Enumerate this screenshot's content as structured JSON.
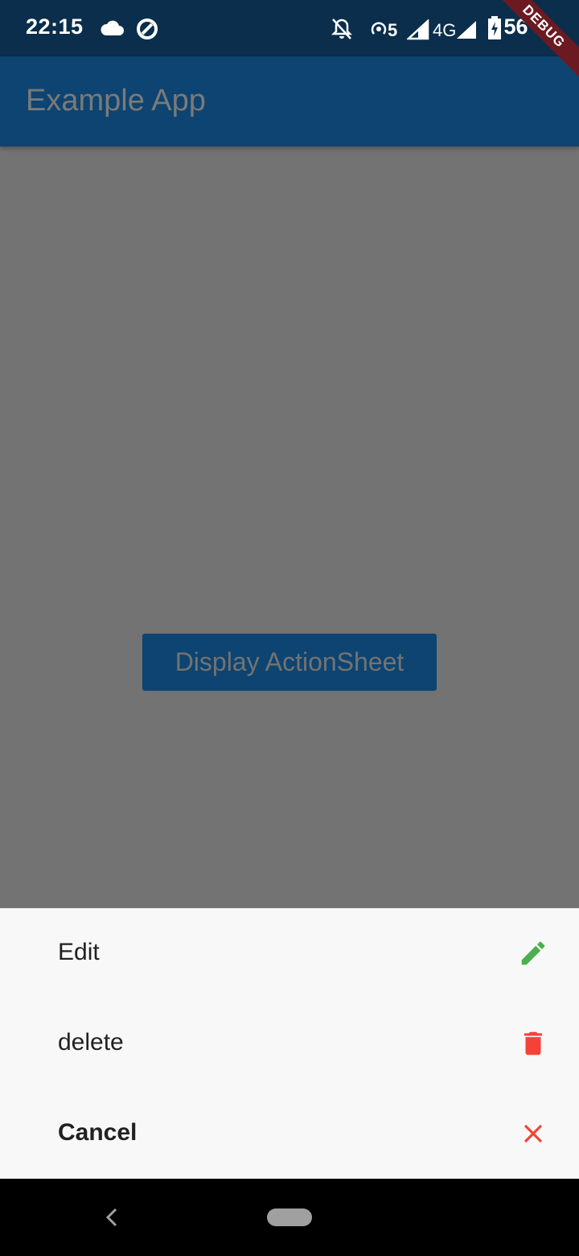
{
  "status_bar": {
    "time": "22:15",
    "network_label": "4G",
    "hotspot_count": "5",
    "battery": "56 %",
    "icons": [
      "cloud-icon",
      "circle-a-icon",
      "notifications-off-icon",
      "hotspot-icon",
      "signal-icon",
      "signal-icon",
      "battery-charging-icon"
    ]
  },
  "debug_banner": "DEBUG",
  "app_bar": {
    "title": "Example App"
  },
  "main": {
    "button_label": "Display ActionSheet"
  },
  "action_sheet": {
    "items": [
      {
        "label": "Edit",
        "icon": "edit-icon",
        "icon_color": "#4caf50"
      },
      {
        "label": "delete",
        "icon": "delete-icon",
        "icon_color": "#f44336"
      },
      {
        "label": "Cancel",
        "icon": "close-icon",
        "icon_color": "#f44336"
      }
    ]
  },
  "nav_bar": {
    "icons": [
      "back-icon",
      "home-pill"
    ]
  },
  "colors": {
    "primary": "#0d4471",
    "status_bar": "#0a2e4b",
    "scrim": "#737373",
    "sheet_bg": "#f8f8f8"
  }
}
